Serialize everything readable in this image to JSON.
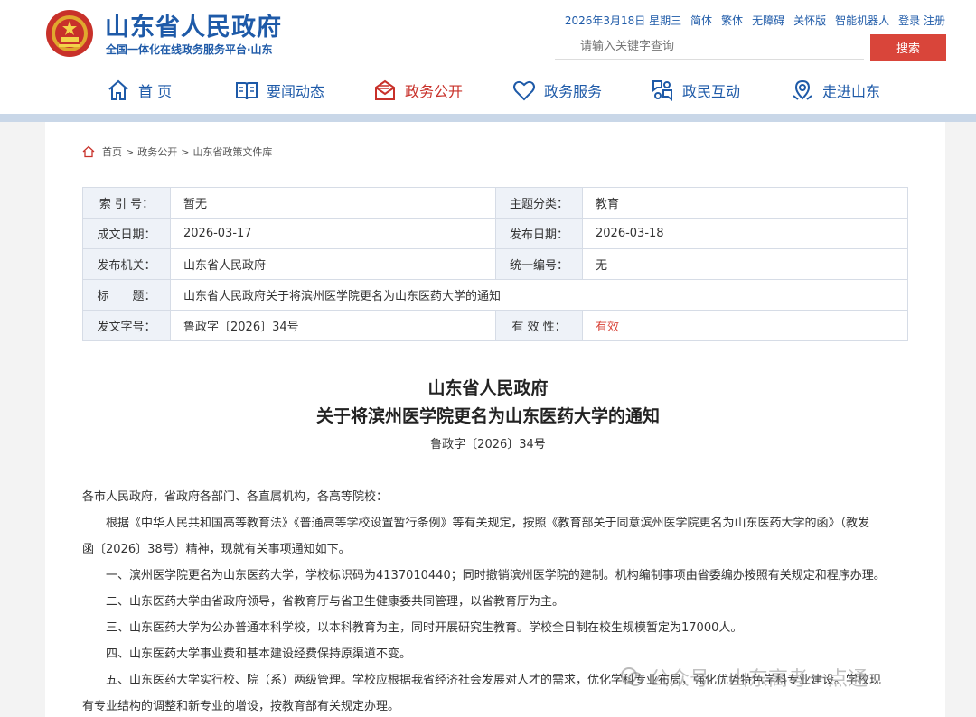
{
  "header": {
    "site_title": "山东省人民政府",
    "site_subtitle": "全国一体化在线政务服务平台·山东",
    "top_links": [
      "2026年3月18日 星期三",
      "简体",
      "繁体",
      "无障碍",
      "关怀版",
      "智能机器人",
      "登录 注册"
    ],
    "search_placeholder": "请输入关键字查询",
    "search_button": "搜索"
  },
  "nav": {
    "items": [
      {
        "label": "首 页",
        "icon": "home-icon"
      },
      {
        "label": "要闻动态",
        "icon": "news-icon"
      },
      {
        "label": "政务公开",
        "icon": "open-gov-icon",
        "active": true
      },
      {
        "label": "政务服务",
        "icon": "heart-icon"
      },
      {
        "label": "政民互动",
        "icon": "interaction-icon"
      },
      {
        "label": "走进山东",
        "icon": "location-icon"
      }
    ]
  },
  "breadcrumb": {
    "home": "首页",
    "sep": ">",
    "level2": "政务公开",
    "level3": "山东省政策文件库"
  },
  "meta": {
    "index_label": "索 引 号：",
    "index_value": "暂无",
    "category_label": "主题分类：",
    "category_value": "教育",
    "created_label": "成文日期：",
    "created_value": "2026-03-17",
    "published_label": "发布日期：",
    "published_value": "2026-03-18",
    "issuer_label": "发布机关：",
    "issuer_value": "山东省人民政府",
    "serial_label": "统一编号：",
    "serial_value": "无",
    "title_label": "标　　题：",
    "title_value": "山东省人民政府关于将滨州医学院更名为山东医药大学的通知",
    "docnum_label": "发文字号：",
    "docnum_value": "鲁政字〔2026〕34号",
    "validity_label": "有 效 性：",
    "validity_value": "有效"
  },
  "document": {
    "title_line1": "山东省人民政府",
    "title_line2": "关于将滨州医学院更名为山东医药大学的通知",
    "doc_number": "鲁政字〔2026〕34号",
    "salutation": "各市人民政府，省政府各部门、各直属机构，各高等院校：",
    "para_intro_1": "根据《中华人民共和国高等教育法》《普通高等学校设置暂行条例》等有关规定，按照《教育部关于同意滨州医学院更名为山东医药大学的函》（教发",
    "para_intro_2": "函〔2026〕38号）精神，现就有关事项通知如下。",
    "item1": "一、滨州医学院更名为山东医药大学，学校标识码为4137010440；同时撤销滨州医学院的建制。机构编制事项由省委编办按照有关规定和程序办理。",
    "item2": "二、山东医药大学由省政府领导，省教育厅与省卫生健康委共同管理，以省教育厅为主。",
    "item3": "三、山东医药大学为公办普通本科学校，以本科教育为主，同时开展研究生教育。学校全日制在校生规模暂定为17000人。",
    "item4": "四、山东医药大学事业费和基本建设经费保持原渠道不变。",
    "item5_1": "五、山东医药大学实行校、院（系）两级管理。学校应根据我省经济社会发展对人才的需求，优化学科专业布局，强化优势特色学科专业建设。学校现",
    "item5_2": "有专业结构的调整和新专业的增设，按教育部有关规定办理。"
  },
  "watermark": {
    "text": "公众号 · 山东高考一点通"
  }
}
